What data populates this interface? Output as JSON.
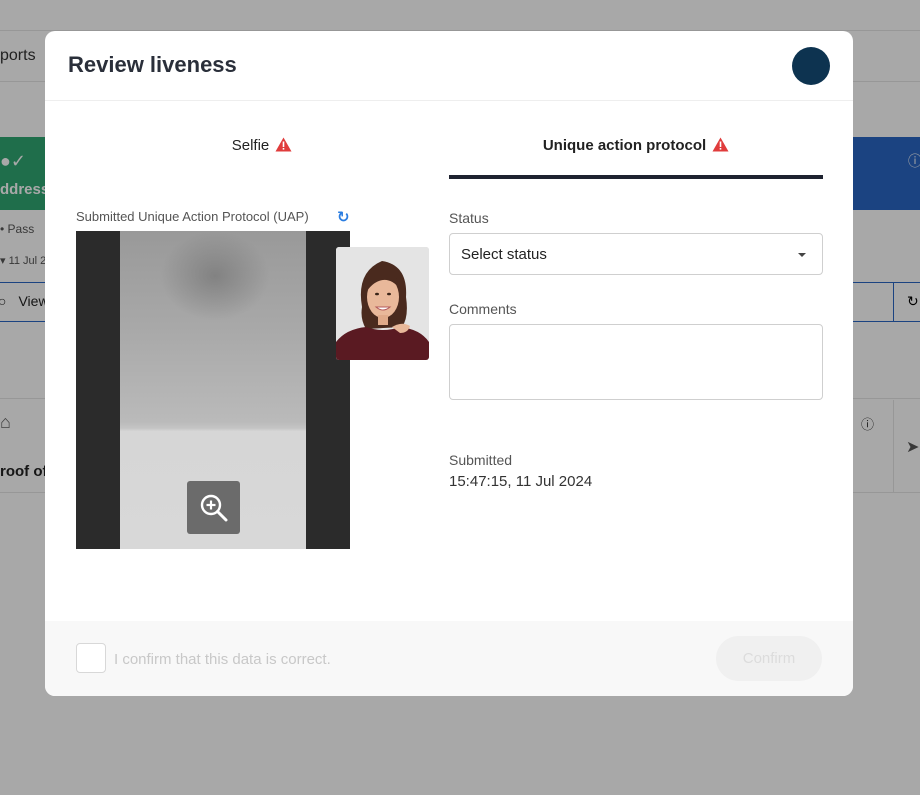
{
  "background": {
    "reports_label": "ports",
    "address_label": "ddress",
    "pass_label": "Pass",
    "date_label": "11 Jul 2",
    "view_label": "View",
    "proof_label": "roof of"
  },
  "modal": {
    "title": "Review liveness",
    "tabs": [
      {
        "label": "Selfie",
        "warning": true,
        "active": false
      },
      {
        "label": "Unique action protocol",
        "warning": true,
        "active": true
      }
    ],
    "uap_label": "Submitted Unique Action Protocol (UAP)",
    "status": {
      "label": "Status",
      "placeholder": "Select status"
    },
    "comments": {
      "label": "Comments",
      "value": ""
    },
    "submitted": {
      "label": "Submitted",
      "value": "15:47:15, 11 Jul 2024"
    },
    "footer": {
      "confirm_text": "I confirm that this data is correct.",
      "confirm_button": "Confirm"
    }
  },
  "colors": {
    "avatar": "#0d3350",
    "warning": "#e03c3c",
    "refresh": "#2a7de1",
    "active_tab_underline": "#1e2230"
  }
}
